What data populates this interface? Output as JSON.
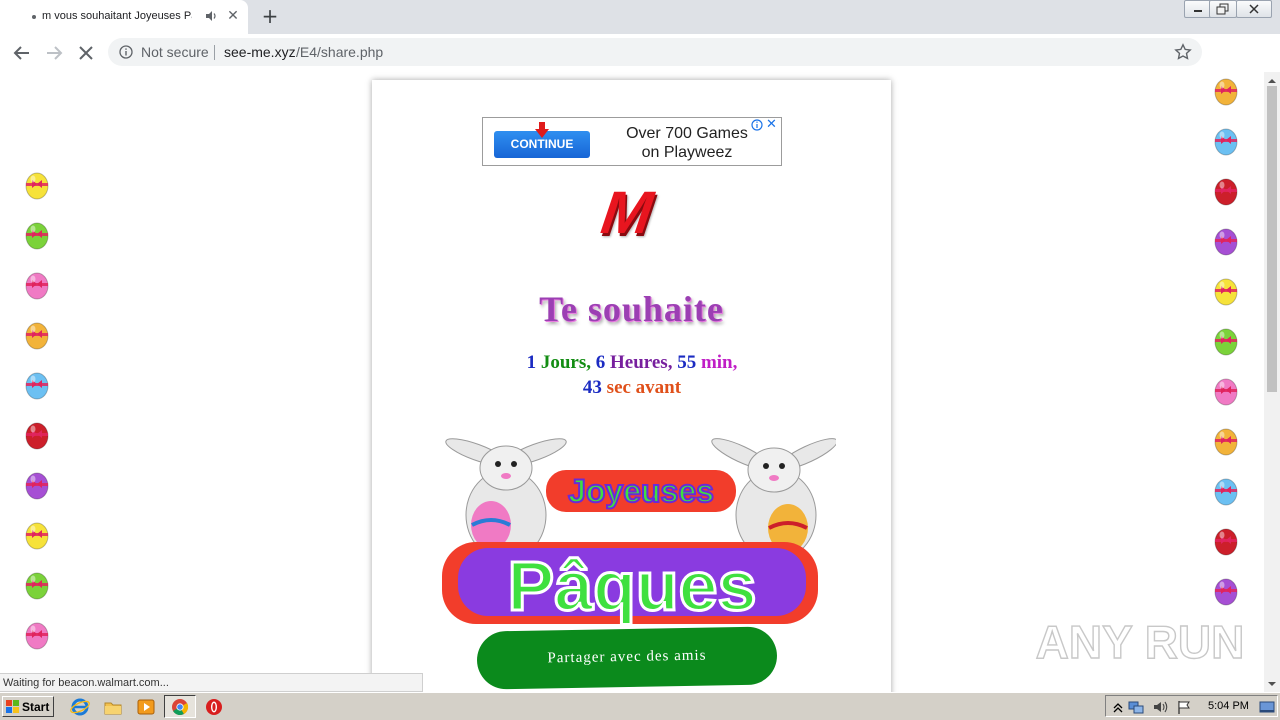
{
  "browser": {
    "tab_title": "m vous souhaitant Joyeuses Pâ",
    "security_label": "Not secure",
    "url_host": "see-me.xyz",
    "url_path": "/E4/share.php",
    "status_text": "Waiting for beacon.walmart.com..."
  },
  "ad": {
    "button_label": "CONTINUE",
    "line1": "Over 700 Games",
    "line2": "on Playweez",
    "close_label": "✕"
  },
  "page": {
    "initial": "M",
    "wish": "Te souhaite",
    "countdown": {
      "days_value": "1",
      "days_label": "Jours,",
      "hours_value": "6",
      "hours_label": "Heures,",
      "minutes_value": "55",
      "minutes_label": "min,",
      "seconds_value": "43",
      "seconds_label": "sec avant"
    },
    "banner_top": "Joyeuses",
    "banner_bottom": "Pâques",
    "share_label": "Partager avec des amis"
  },
  "watermark": "ANY RUN",
  "taskbar": {
    "start_label": "Start",
    "clock": "5:04 PM"
  },
  "egg_colors": [
    "#f6e23a",
    "#7bd23a",
    "#f07ac4",
    "#f2b33a",
    "#6cc0f2",
    "#cc1f2a",
    "#a64fd4"
  ]
}
